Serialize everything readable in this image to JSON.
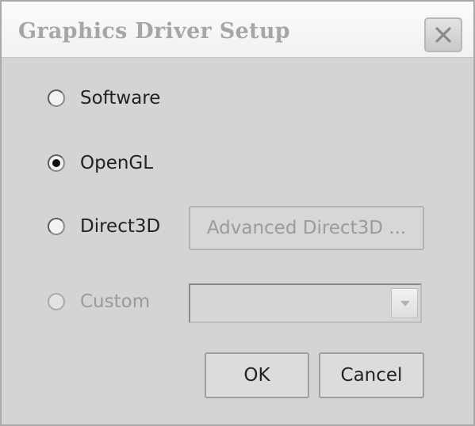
{
  "window": {
    "title": "Graphics Driver Setup",
    "close_icon": "close-icon"
  },
  "drivers": {
    "software_label": "Software",
    "opengl_label": "OpenGL",
    "direct3d_label": "Direct3D",
    "custom_label": "Custom",
    "selected": "OpenGL"
  },
  "advanced_direct3d": {
    "label": "Advanced Direct3D ..."
  },
  "custom_select": {
    "value": ""
  },
  "actions": {
    "ok_label": "OK",
    "cancel_label": "Cancel"
  }
}
